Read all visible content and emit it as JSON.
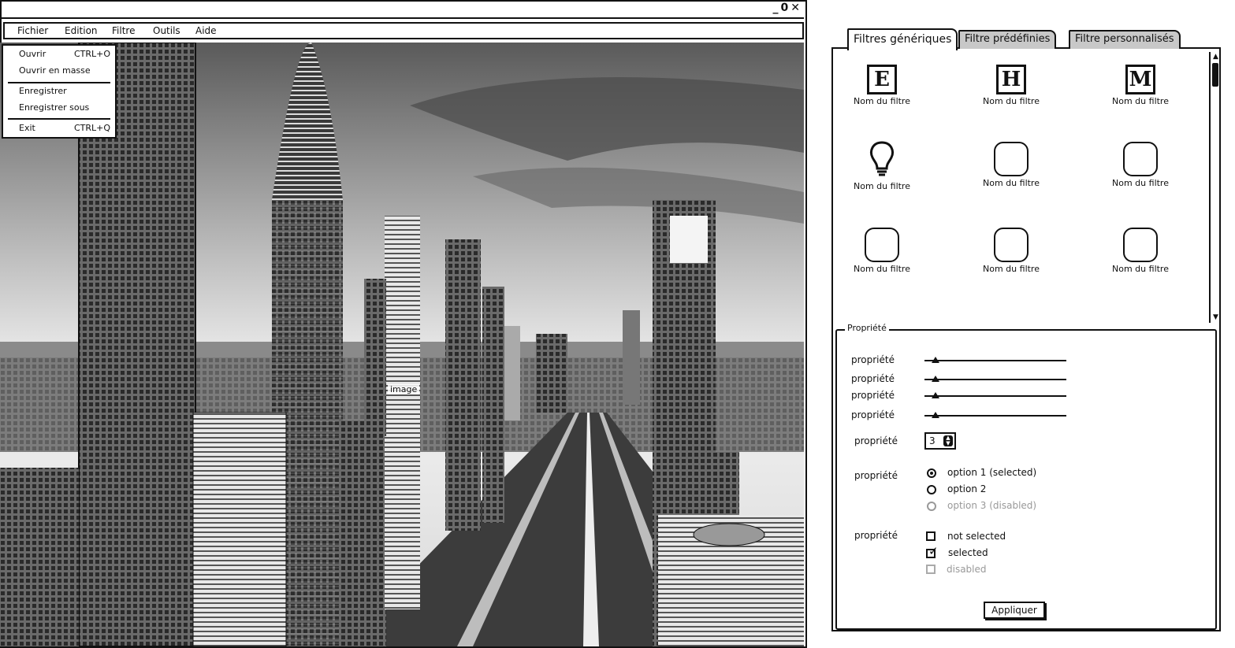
{
  "window": {
    "controls": [
      "_",
      "0",
      "✕"
    ]
  },
  "menu_bar": {
    "items": [
      "Fichier",
      "Edition",
      "Filtre",
      "Outils",
      "Aide"
    ]
  },
  "file_menu": {
    "items": [
      {
        "label": "Ouvrir",
        "shortcut": "CTRL+O"
      },
      {
        "label": "Ouvrir en masse",
        "shortcut": ""
      },
      {
        "label": "Enregistrer",
        "shortcut": ""
      },
      {
        "label": "Enregistrer sous",
        "shortcut": ""
      },
      {
        "label": "Exit",
        "shortcut": "CTRL+Q"
      }
    ]
  },
  "viewport": {
    "image_label": "image"
  },
  "tabs": [
    "Filtres génériques",
    "Filtre prédéfinies",
    "Filtre personnalisés"
  ],
  "filters": [
    {
      "icon": "letter-e-icon",
      "letter": "E",
      "label": "Nom du filtre"
    },
    {
      "icon": "letter-h-icon",
      "letter": "H",
      "label": "Nom du filtre"
    },
    {
      "icon": "letter-m-icon",
      "letter": "M",
      "label": "Nom du filtre"
    },
    {
      "icon": "lightbulb-icon",
      "letter": "",
      "label": "Nom du filtre"
    },
    {
      "icon": "blank-placeholder-icon",
      "letter": "",
      "label": "Nom du filtre"
    },
    {
      "icon": "blank-placeholder-icon",
      "letter": "",
      "label": "Nom du filtre"
    },
    {
      "icon": "blank-placeholder-icon",
      "letter": "",
      "label": "Nom du filtre"
    },
    {
      "icon": "blank-placeholder-icon",
      "letter": "",
      "label": "Nom du filtre"
    },
    {
      "icon": "blank-placeholder-icon",
      "letter": "",
      "label": "Nom du filtre"
    }
  ],
  "properties": {
    "legend": "Propriété",
    "sliders": [
      {
        "label": "propriété",
        "value": 0.08
      },
      {
        "label": "propriété",
        "value": 0.08
      },
      {
        "label": "propriété",
        "value": 0.08
      },
      {
        "label": "propriété",
        "value": 0.08
      }
    ],
    "stepper": {
      "label": "propriété",
      "value": "3"
    },
    "radio": {
      "label": "propriété",
      "options": [
        {
          "text": "option 1 (selected)",
          "state": "selected"
        },
        {
          "text": "option 2",
          "state": "normal"
        },
        {
          "text": "option 3 (disabled)",
          "state": "disabled"
        }
      ]
    },
    "checkbox": {
      "label": "propriété",
      "options": [
        {
          "text": "not selected",
          "state": "unchecked"
        },
        {
          "text": "selected",
          "state": "checked"
        },
        {
          "text": "disabled",
          "state": "disabled"
        }
      ]
    },
    "apply_label": "Appliquer"
  }
}
